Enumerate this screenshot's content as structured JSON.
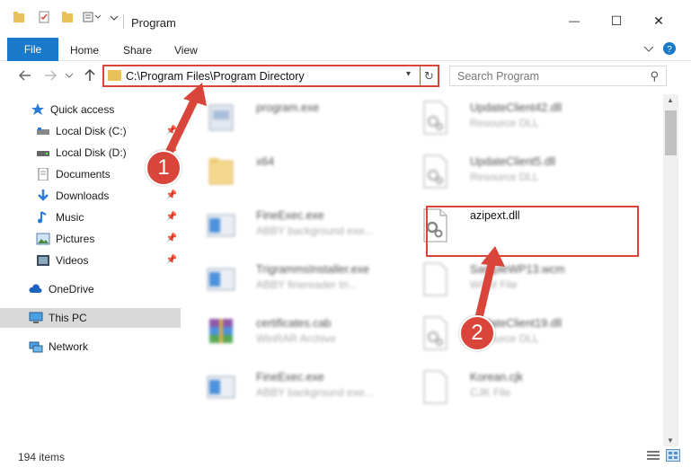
{
  "titlebar": {
    "title": "Program",
    "minimize": "—",
    "maximize": "☐",
    "close": "✕"
  },
  "ribbon": {
    "file": "File",
    "home": "Home",
    "share": "Share",
    "view": "View"
  },
  "address": {
    "path": "C:\\Program Files\\Program Directory"
  },
  "search": {
    "placeholder": "Search Program"
  },
  "nav": {
    "items": [
      {
        "label": "Quick access",
        "icon": "star-icon"
      },
      {
        "label": "Local Disk (C:)",
        "icon": "drive-icon"
      },
      {
        "label": "Local Disk (D:)",
        "icon": "drive-icon"
      },
      {
        "label": "Documents",
        "icon": "documents-icon"
      },
      {
        "label": "Downloads",
        "icon": "downloads-icon"
      },
      {
        "label": "Music",
        "icon": "music-icon"
      },
      {
        "label": "Pictures",
        "icon": "pictures-icon"
      },
      {
        "label": "Videos",
        "icon": "videos-icon"
      },
      {
        "label": "OneDrive",
        "icon": "cloud-icon"
      },
      {
        "label": "This PC",
        "icon": "computer-icon"
      },
      {
        "label": "Network",
        "icon": "network-icon"
      }
    ]
  },
  "files": {
    "left": [
      {
        "name": "program.exe",
        "desc": ""
      },
      {
        "name": "x64",
        "desc": ""
      },
      {
        "name": "FineExec.exe",
        "desc": "ABBY background exe..."
      },
      {
        "name": "TrigrammsInstaller.exe",
        "desc": "ABBY finereader tri..."
      },
      {
        "name": "certificates.cab",
        "desc": "WinRAR Archive"
      },
      {
        "name": "FineExec.exe",
        "desc": "ABBY background exe..."
      }
    ],
    "right": [
      {
        "name": "UpdateClient42.dll",
        "desc": "Resource DLL"
      },
      {
        "name": "UpdateClient5.dll",
        "desc": "Resource DLL"
      },
      {
        "name": "azipext.dll",
        "desc": ""
      },
      {
        "name": "SampleWP13.wcm",
        "desc": "WCM File"
      },
      {
        "name": "UpdateClient19.dll",
        "desc": "Resource DLL"
      },
      {
        "name": "Korean.cjk",
        "desc": "CJK File"
      }
    ]
  },
  "status": {
    "count": "194 items"
  },
  "annotations": {
    "badge1": "1",
    "badge2": "2",
    "color": "#d9453b"
  }
}
